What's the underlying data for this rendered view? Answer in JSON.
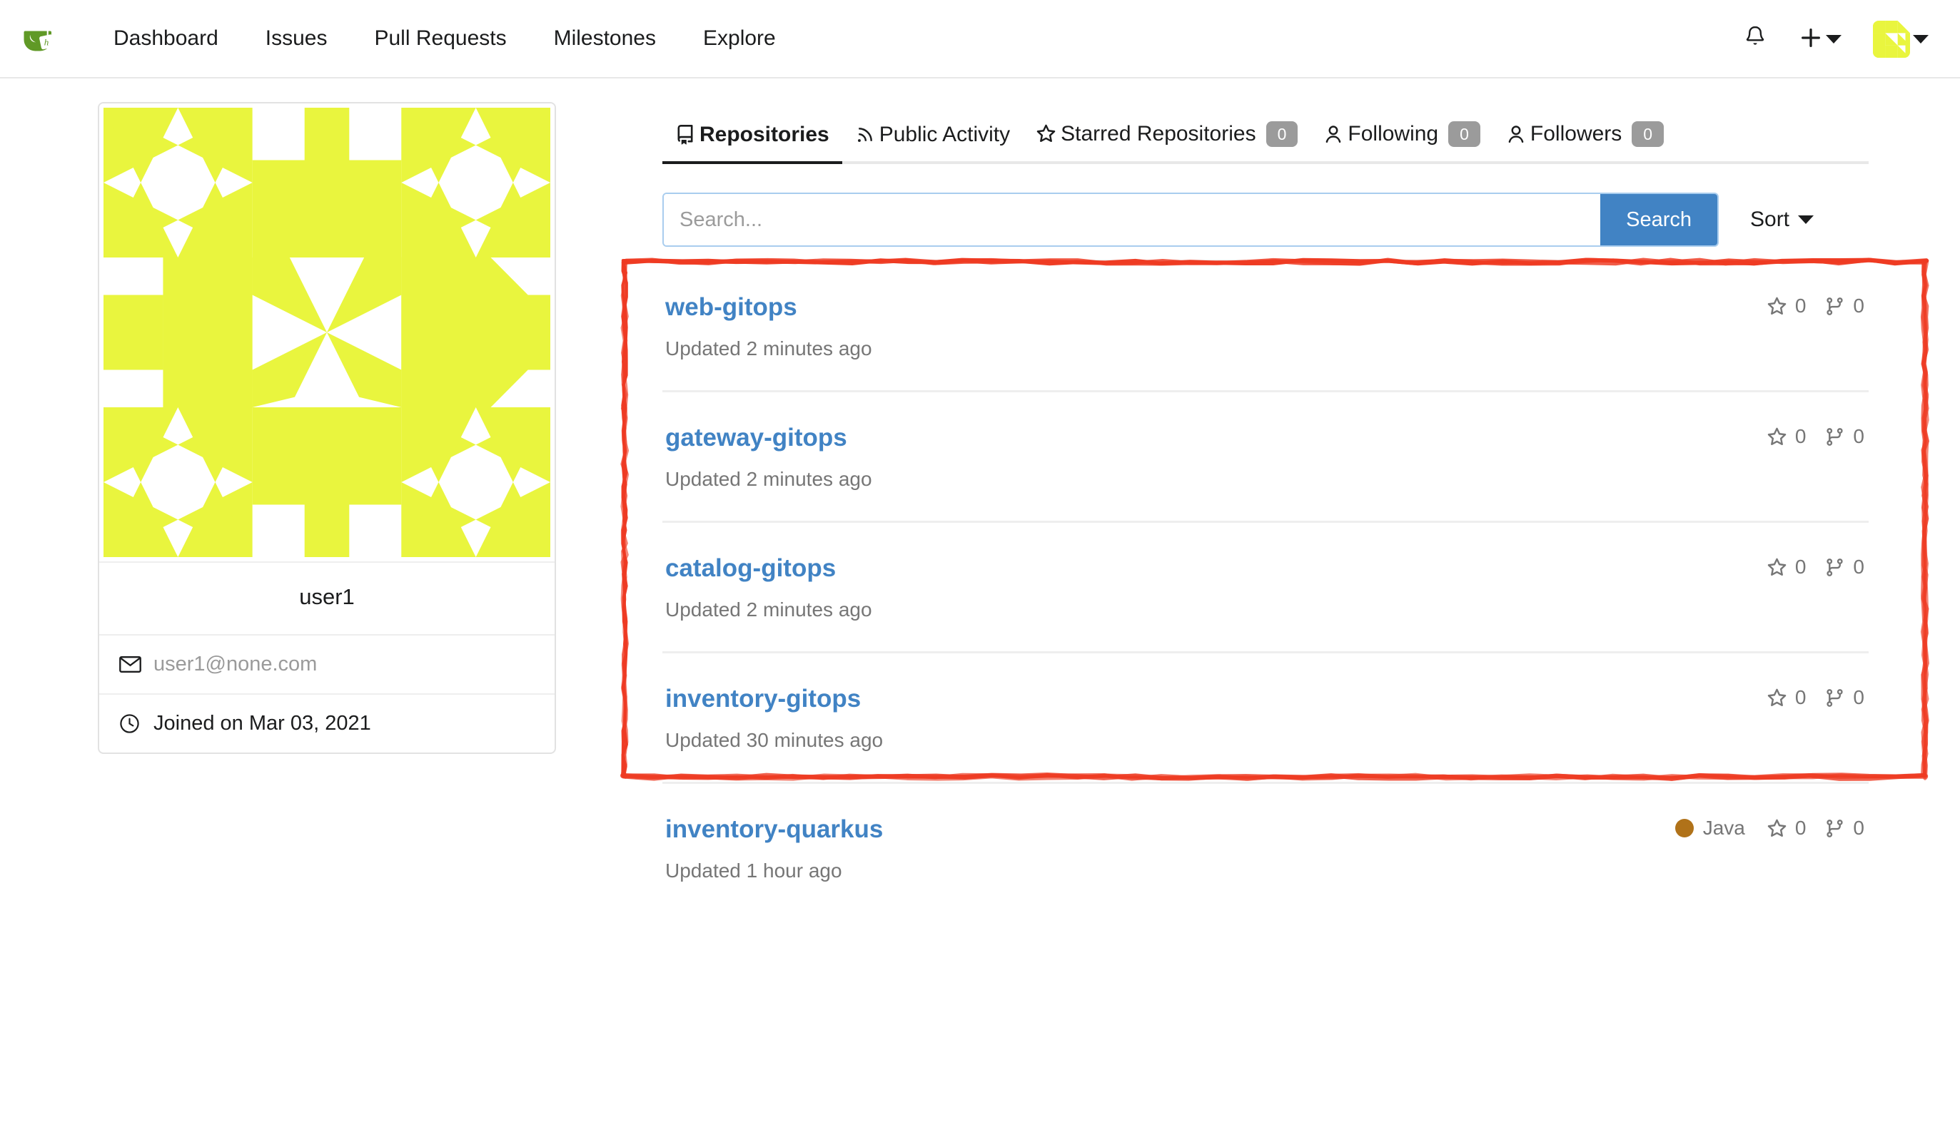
{
  "navbar": {
    "logo_icon": "gitea-teacup-logo",
    "links": [
      {
        "label": "Dashboard",
        "name": "nav-link-dashboard"
      },
      {
        "label": "Issues",
        "name": "nav-link-issues"
      },
      {
        "label": "Pull Requests",
        "name": "nav-link-pull-requests"
      },
      {
        "label": "Milestones",
        "name": "nav-link-milestones"
      },
      {
        "label": "Explore",
        "name": "nav-link-explore"
      }
    ],
    "notification_icon": "bell-icon",
    "create_icon": "plus-icon",
    "create_caret_icon": "chevron-down-icon",
    "avatar_icon": "user-avatar-identicon",
    "avatar_caret_icon": "chevron-down-icon"
  },
  "profile": {
    "avatar_icon": "user-avatar-identicon-large",
    "username": "user1",
    "email": "user1@none.com",
    "email_icon": "mail-icon",
    "joined": "Joined on Mar 03, 2021",
    "joined_icon": "clock-icon"
  },
  "tabs": [
    {
      "label": "Repositories",
      "icon": "repo-icon",
      "badge": null,
      "active": true
    },
    {
      "label": "Public Activity",
      "icon": "rss-icon",
      "badge": null,
      "active": false
    },
    {
      "label": "Starred Repositories",
      "icon": "star-icon",
      "badge": "0",
      "active": false
    },
    {
      "label": "Following",
      "icon": "person-icon",
      "badge": "0",
      "active": false
    },
    {
      "label": "Followers",
      "icon": "person-icon",
      "badge": "0",
      "active": false
    }
  ],
  "search": {
    "placeholder": "Search...",
    "value": "",
    "button_label": "Search",
    "sort_label": "Sort",
    "sort_caret_icon": "chevron-down-icon"
  },
  "repos": [
    {
      "name": "web-gitops",
      "updated": "Updated 2 minutes ago",
      "language": null,
      "language_color": null,
      "stars": "0",
      "forks": "0",
      "highlighted": true
    },
    {
      "name": "gateway-gitops",
      "updated": "Updated 2 minutes ago",
      "language": null,
      "language_color": null,
      "stars": "0",
      "forks": "0",
      "highlighted": true
    },
    {
      "name": "catalog-gitops",
      "updated": "Updated 2 minutes ago",
      "language": null,
      "language_color": null,
      "stars": "0",
      "forks": "0",
      "highlighted": true
    },
    {
      "name": "inventory-gitops",
      "updated": "Updated 30 minutes ago",
      "language": null,
      "language_color": null,
      "stars": "0",
      "forks": "0",
      "highlighted": false
    },
    {
      "name": "inventory-quarkus",
      "updated": "Updated 1 hour ago",
      "language": "Java",
      "language_color": "#b07219",
      "stars": "0",
      "forks": "0",
      "highlighted": false
    }
  ],
  "annotation": {
    "type": "rough-rectangle-highlight",
    "color": "#ee3b23"
  },
  "colors": {
    "link_blue": "#4183c4",
    "button_blue": "#4183c4",
    "badge_gray": "#9b9b9b",
    "muted_text": "#767676",
    "avatar_yellow": "#e9f53e",
    "java_dot": "#b07219",
    "annotation_red": "#ee3b23"
  }
}
